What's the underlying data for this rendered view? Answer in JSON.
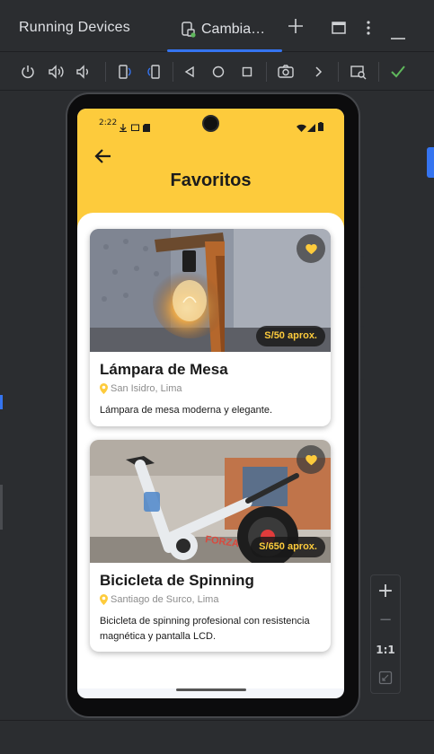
{
  "ide": {
    "panel_title": "Running Devices",
    "tab_label": "Cambia…",
    "add_tab": "+",
    "toolbar_icons": [
      "power-icon",
      "volume-up-icon",
      "volume-down-icon",
      "rotate-left-icon",
      "rotate-right-icon",
      "back-icon",
      "home-icon",
      "overview-icon",
      "screenshot-icon",
      "more-icon",
      "screen-record-icon",
      "check-icon"
    ],
    "zoom": {
      "plus": "+",
      "minus": "−",
      "one_to_one": "1:1"
    }
  },
  "phone": {
    "status_time": "2:22",
    "header_title": "Favoritos",
    "accent": "#fdcb3c"
  },
  "cards": [
    {
      "title": "Lámpara de Mesa",
      "location": "San Isidro, Lima",
      "description": "Lámpara de mesa moderna y elegante.",
      "price": "S/50 aprox."
    },
    {
      "title": "Bicicleta de Spinning",
      "location": "Santiago de Surco, Lima",
      "description": "Bicicleta de spinning profesional con resistencia magnética y pantalla LCD.",
      "price": "S/650 aprox."
    }
  ]
}
